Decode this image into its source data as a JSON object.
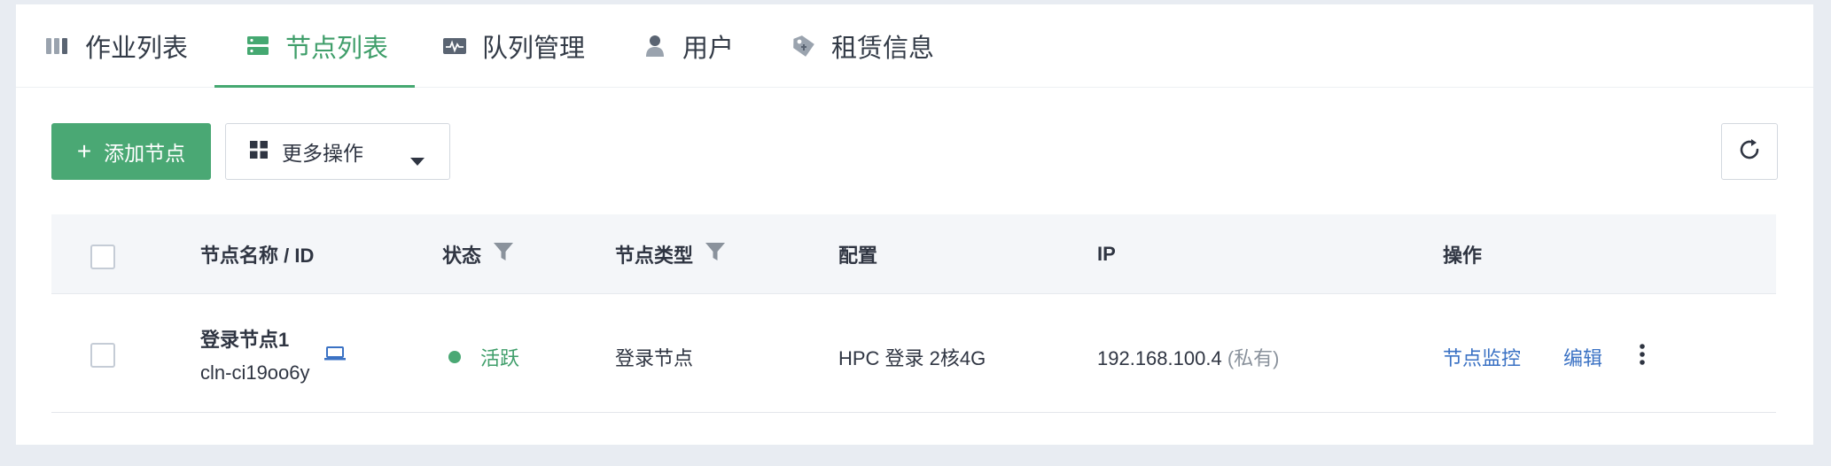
{
  "tabs": [
    {
      "label": "作业列表",
      "icon": "job-list-icon",
      "active": false
    },
    {
      "label": "节点列表",
      "icon": "node-list-icon",
      "active": true
    },
    {
      "label": "队列管理",
      "icon": "queue-icon",
      "active": false
    },
    {
      "label": "用户",
      "icon": "user-icon",
      "active": false
    },
    {
      "label": "租赁信息",
      "icon": "lease-tag-icon",
      "active": false
    }
  ],
  "toolbar": {
    "add_label": "添加节点",
    "more_label": "更多操作"
  },
  "table": {
    "headers": {
      "name": "节点名称 / ID",
      "status": "状态",
      "type": "节点类型",
      "config": "配置",
      "ip": "IP",
      "actions": "操作"
    },
    "rows": [
      {
        "name": "登录节点1",
        "id": "cln-ci19oo6y",
        "status": "活跃",
        "type": "登录节点",
        "config": "HPC 登录 2核4G",
        "ip": "192.168.100.4",
        "ip_note": "(私有)",
        "action_monitor": "节点监控",
        "action_edit": "编辑"
      }
    ]
  },
  "colors": {
    "accent": "#4aa874",
    "link": "#3b72c4",
    "background": "#e8ecf2"
  }
}
